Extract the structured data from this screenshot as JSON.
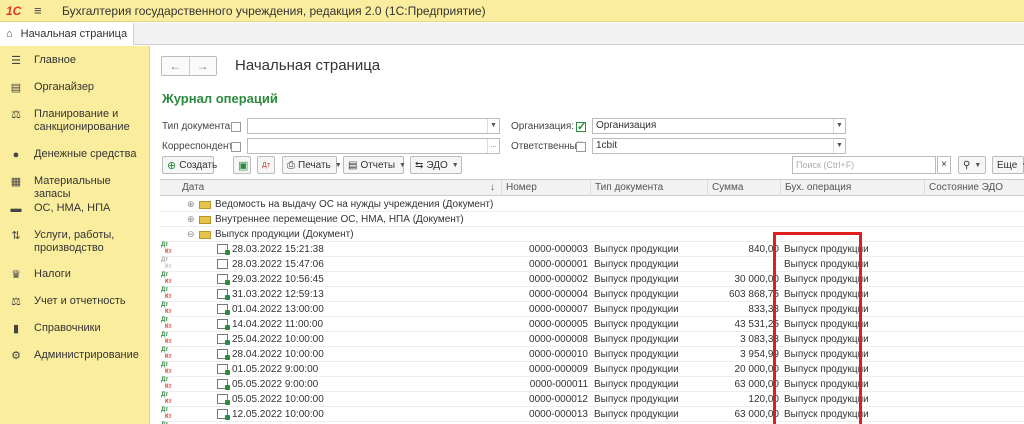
{
  "app": {
    "logo": "1С",
    "title": "Бухгалтерия государственного учреждения, редакция 2.0  (1С:Предприятие)"
  },
  "tab": {
    "label": "Начальная страница"
  },
  "sidebar": {
    "items": [
      {
        "label": "Главное",
        "icon": "list-icon",
        "glyph": "☰"
      },
      {
        "label": "Органайзер",
        "icon": "organizer-icon",
        "glyph": "▤"
      },
      {
        "label": "Планирование и санкционирование",
        "icon": "planning-icon",
        "glyph": "⚖"
      },
      {
        "label": "Денежные средства",
        "icon": "money-icon",
        "glyph": "●"
      },
      {
        "label": "Материальные запасы",
        "icon": "stock-icon",
        "glyph": "▦"
      },
      {
        "label": "ОС, НМА, НПА",
        "icon": "truck-icon",
        "glyph": "▬"
      },
      {
        "label": "Услуги, работы, производство",
        "icon": "services-icon",
        "glyph": "⇅"
      },
      {
        "label": "Налоги",
        "icon": "taxes-icon",
        "glyph": "♛"
      },
      {
        "label": "Учет и отчетность",
        "icon": "accounting-icon",
        "glyph": "⚖"
      },
      {
        "label": "Справочники",
        "icon": "books-icon",
        "glyph": "▮"
      },
      {
        "label": "Администрирование",
        "icon": "gear-icon",
        "glyph": "⚙"
      }
    ]
  },
  "page": {
    "title": "Начальная страница",
    "journal_title": "Журнал операций"
  },
  "filters": {
    "doc_type_label": "Тип документа:",
    "org_label": "Организация:",
    "org_value": "Организация",
    "org_checked": true,
    "corr_label": "Корреспондент:",
    "resp_label": "Ответственный:",
    "resp_value": "1cbit"
  },
  "toolbar": {
    "create": "Создать",
    "print": "Печать",
    "reports": "Отчеты",
    "edo": "ЭДО",
    "search_placeholder": "Поиск (Ctrl+F)",
    "more": "Еще"
  },
  "table": {
    "columns": [
      "Дата",
      "Номер",
      "Тип документа",
      "Сумма",
      "Бух. операция",
      "Состояние ЭДО"
    ],
    "groups": [
      {
        "label": "Ведомость на выдачу ОС на нужды учреждения (Документ)",
        "expanded": false
      },
      {
        "label": "Внутреннее перемещение ОС, НМА, НПА (Документ)",
        "expanded": false
      },
      {
        "label": "Выпуск продукции (Документ)",
        "expanded": true
      }
    ],
    "rows": [
      {
        "date": "28.03.2022 15:21:38",
        "number": "0000-000003",
        "type": "Выпуск продукции",
        "sum": "840,00",
        "op": "Выпуск продукции",
        "posted": true
      },
      {
        "date": "28.03.2022 15:47:06",
        "number": "0000-000001",
        "type": "Выпуск продукции",
        "sum": "",
        "op": "Выпуск продукции",
        "posted": false
      },
      {
        "date": "29.03.2022 10:56:45",
        "number": "0000-000002",
        "type": "Выпуск продукции",
        "sum": "30 000,00",
        "op": "Выпуск продукции",
        "posted": true
      },
      {
        "date": "31.03.2022 12:59:13",
        "number": "0000-000004",
        "type": "Выпуск продукции",
        "sum": "603 868,75",
        "op": "Выпуск продукции",
        "posted": true
      },
      {
        "date": "01.04.2022 13:00:00",
        "number": "0000-000007",
        "type": "Выпуск продукции",
        "sum": "833,33",
        "op": "Выпуск продукции",
        "posted": true
      },
      {
        "date": "14.04.2022 11:00:00",
        "number": "0000-000005",
        "type": "Выпуск продукции",
        "sum": "43 531,25",
        "op": "Выпуск продукции",
        "posted": true
      },
      {
        "date": "25.04.2022 10:00:00",
        "number": "0000-000008",
        "type": "Выпуск продукции",
        "sum": "3 083,33",
        "op": "Выпуск продукции",
        "posted": true
      },
      {
        "date": "28.04.2022 10:00:00",
        "number": "0000-000010",
        "type": "Выпуск продукции",
        "sum": "3 954,99",
        "op": "Выпуск продукции",
        "posted": true
      },
      {
        "date": "01.05.2022 9:00:00",
        "number": "0000-000009",
        "type": "Выпуск продукции",
        "sum": "20 000,00",
        "op": "Выпуск продукции",
        "posted": true
      },
      {
        "date": "05.05.2022 9:00:00",
        "number": "0000-000011",
        "type": "Выпуск продукции",
        "sum": "63 000,00",
        "op": "Выпуск продукции",
        "posted": true
      },
      {
        "date": "05.05.2022 10:00:00",
        "number": "0000-000012",
        "type": "Выпуск продукции",
        "sum": "120,00",
        "op": "Выпуск продукции",
        "posted": true
      },
      {
        "date": "12.05.2022 10:00:00",
        "number": "0000-000013",
        "type": "Выпуск продукции",
        "sum": "63 000,00",
        "op": "Выпуск продукции",
        "posted": true
      },
      {
        "date": "13.05.2022 10:00:00",
        "number": "0000-000014",
        "type": "Выпуск продукции",
        "sum": "63 000,00",
        "op": "Выпуск продукции",
        "posted": true
      }
    ]
  },
  "colors": {
    "accent": "#2c8a3e",
    "panel": "#fbed9e",
    "highlight": "#e01e1e"
  }
}
